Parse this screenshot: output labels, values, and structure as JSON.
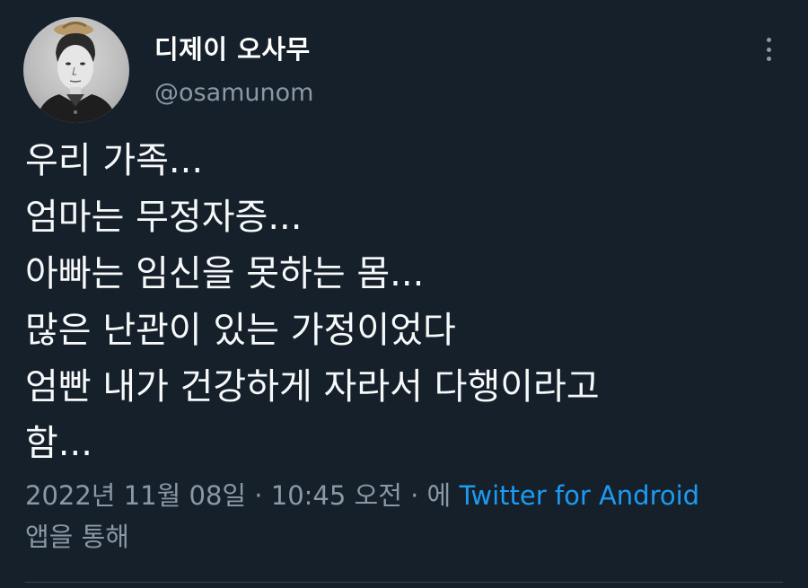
{
  "tweet": {
    "author": {
      "display_name": "디제이 오사무",
      "handle": "@osamunom",
      "avatar_icon": "portrait-avatar"
    },
    "more_icon": "more-vertical-icon",
    "lines": [
      "우리 가족...",
      "엄마는 무정자증...",
      "아빠는 임신을 못하는 몸...",
      "많은 난관이 있는 가정이었다",
      "엄빤 내가 건강하게 자라서 다행이라고",
      "함..."
    ],
    "meta": {
      "timestamp": "2022년 11월 08일 · 10:45 오전 · 에",
      "source": "Twitter for Android",
      "suffix": "앱을 통해"
    },
    "colors": {
      "background": "#15202b",
      "text": "#f7f9f9",
      "secondary": "#8b98a5",
      "link": "#1d9bf0"
    }
  }
}
